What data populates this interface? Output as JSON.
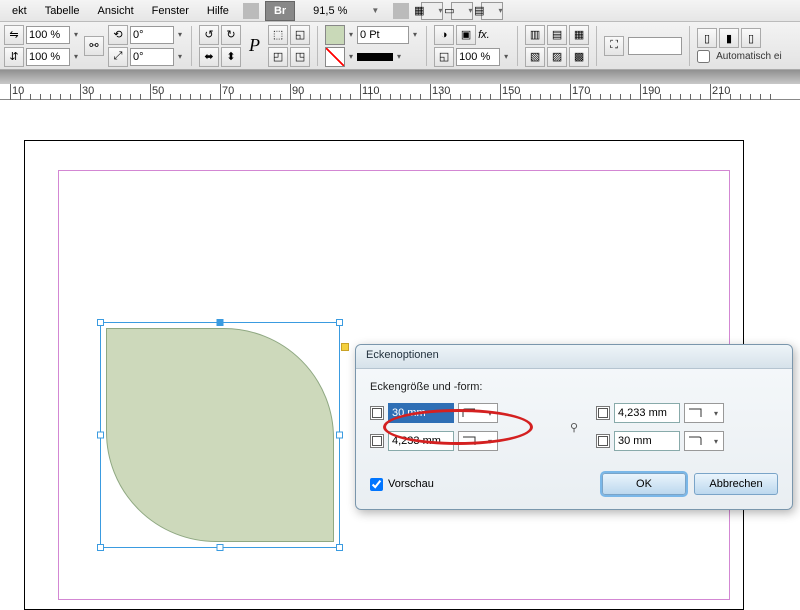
{
  "menu": {
    "items": [
      "ekt",
      "Tabelle",
      "Ansicht",
      "Fenster",
      "Hilfe"
    ],
    "br": "Br",
    "zoom": "91,5 %"
  },
  "toolbar": {
    "opacity1": "100 %",
    "opacity2": "100 %",
    "angle1": "0°",
    "angle2": "0°",
    "stroke": "0 Pt",
    "scale": "100 %",
    "auto": "Automatisch ei",
    "text_tool": "P"
  },
  "ruler": {
    "marks": [
      "10",
      "30",
      "50",
      "70",
      "90",
      "110",
      "130",
      "150",
      "170",
      "190",
      "210"
    ]
  },
  "dialog": {
    "title": "Eckenoptionen",
    "group": "Eckengröße und -form:",
    "tl": "30 mm",
    "tr": "4,233 mm",
    "bl": "4,233 mm",
    "br": "30 mm",
    "preview": "Vorschau",
    "ok": "OK",
    "cancel": "Abbrechen"
  }
}
